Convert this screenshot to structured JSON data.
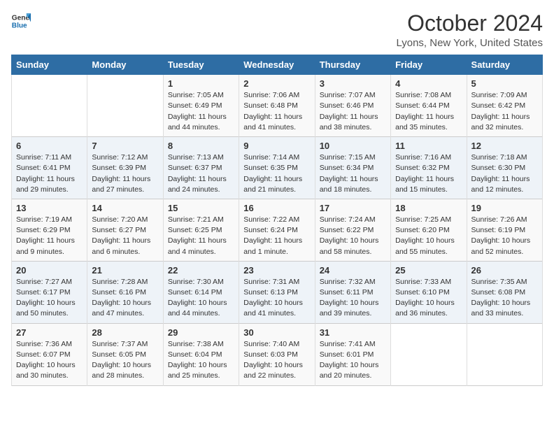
{
  "header": {
    "logo_line1": "General",
    "logo_line2": "Blue",
    "month": "October 2024",
    "location": "Lyons, New York, United States"
  },
  "weekdays": [
    "Sunday",
    "Monday",
    "Tuesday",
    "Wednesday",
    "Thursday",
    "Friday",
    "Saturday"
  ],
  "weeks": [
    [
      {
        "day": "",
        "info": ""
      },
      {
        "day": "",
        "info": ""
      },
      {
        "day": "1",
        "info": "Sunrise: 7:05 AM\nSunset: 6:49 PM\nDaylight: 11 hours and 44 minutes."
      },
      {
        "day": "2",
        "info": "Sunrise: 7:06 AM\nSunset: 6:48 PM\nDaylight: 11 hours and 41 minutes."
      },
      {
        "day": "3",
        "info": "Sunrise: 7:07 AM\nSunset: 6:46 PM\nDaylight: 11 hours and 38 minutes."
      },
      {
        "day": "4",
        "info": "Sunrise: 7:08 AM\nSunset: 6:44 PM\nDaylight: 11 hours and 35 minutes."
      },
      {
        "day": "5",
        "info": "Sunrise: 7:09 AM\nSunset: 6:42 PM\nDaylight: 11 hours and 32 minutes."
      }
    ],
    [
      {
        "day": "6",
        "info": "Sunrise: 7:11 AM\nSunset: 6:41 PM\nDaylight: 11 hours and 29 minutes."
      },
      {
        "day": "7",
        "info": "Sunrise: 7:12 AM\nSunset: 6:39 PM\nDaylight: 11 hours and 27 minutes."
      },
      {
        "day": "8",
        "info": "Sunrise: 7:13 AM\nSunset: 6:37 PM\nDaylight: 11 hours and 24 minutes."
      },
      {
        "day": "9",
        "info": "Sunrise: 7:14 AM\nSunset: 6:35 PM\nDaylight: 11 hours and 21 minutes."
      },
      {
        "day": "10",
        "info": "Sunrise: 7:15 AM\nSunset: 6:34 PM\nDaylight: 11 hours and 18 minutes."
      },
      {
        "day": "11",
        "info": "Sunrise: 7:16 AM\nSunset: 6:32 PM\nDaylight: 11 hours and 15 minutes."
      },
      {
        "day": "12",
        "info": "Sunrise: 7:18 AM\nSunset: 6:30 PM\nDaylight: 11 hours and 12 minutes."
      }
    ],
    [
      {
        "day": "13",
        "info": "Sunrise: 7:19 AM\nSunset: 6:29 PM\nDaylight: 11 hours and 9 minutes."
      },
      {
        "day": "14",
        "info": "Sunrise: 7:20 AM\nSunset: 6:27 PM\nDaylight: 11 hours and 6 minutes."
      },
      {
        "day": "15",
        "info": "Sunrise: 7:21 AM\nSunset: 6:25 PM\nDaylight: 11 hours and 4 minutes."
      },
      {
        "day": "16",
        "info": "Sunrise: 7:22 AM\nSunset: 6:24 PM\nDaylight: 11 hours and 1 minute."
      },
      {
        "day": "17",
        "info": "Sunrise: 7:24 AM\nSunset: 6:22 PM\nDaylight: 10 hours and 58 minutes."
      },
      {
        "day": "18",
        "info": "Sunrise: 7:25 AM\nSunset: 6:20 PM\nDaylight: 10 hours and 55 minutes."
      },
      {
        "day": "19",
        "info": "Sunrise: 7:26 AM\nSunset: 6:19 PM\nDaylight: 10 hours and 52 minutes."
      }
    ],
    [
      {
        "day": "20",
        "info": "Sunrise: 7:27 AM\nSunset: 6:17 PM\nDaylight: 10 hours and 50 minutes."
      },
      {
        "day": "21",
        "info": "Sunrise: 7:28 AM\nSunset: 6:16 PM\nDaylight: 10 hours and 47 minutes."
      },
      {
        "day": "22",
        "info": "Sunrise: 7:30 AM\nSunset: 6:14 PM\nDaylight: 10 hours and 44 minutes."
      },
      {
        "day": "23",
        "info": "Sunrise: 7:31 AM\nSunset: 6:13 PM\nDaylight: 10 hours and 41 minutes."
      },
      {
        "day": "24",
        "info": "Sunrise: 7:32 AM\nSunset: 6:11 PM\nDaylight: 10 hours and 39 minutes."
      },
      {
        "day": "25",
        "info": "Sunrise: 7:33 AM\nSunset: 6:10 PM\nDaylight: 10 hours and 36 minutes."
      },
      {
        "day": "26",
        "info": "Sunrise: 7:35 AM\nSunset: 6:08 PM\nDaylight: 10 hours and 33 minutes."
      }
    ],
    [
      {
        "day": "27",
        "info": "Sunrise: 7:36 AM\nSunset: 6:07 PM\nDaylight: 10 hours and 30 minutes."
      },
      {
        "day": "28",
        "info": "Sunrise: 7:37 AM\nSunset: 6:05 PM\nDaylight: 10 hours and 28 minutes."
      },
      {
        "day": "29",
        "info": "Sunrise: 7:38 AM\nSunset: 6:04 PM\nDaylight: 10 hours and 25 minutes."
      },
      {
        "day": "30",
        "info": "Sunrise: 7:40 AM\nSunset: 6:03 PM\nDaylight: 10 hours and 22 minutes."
      },
      {
        "day": "31",
        "info": "Sunrise: 7:41 AM\nSunset: 6:01 PM\nDaylight: 10 hours and 20 minutes."
      },
      {
        "day": "",
        "info": ""
      },
      {
        "day": "",
        "info": ""
      }
    ]
  ]
}
